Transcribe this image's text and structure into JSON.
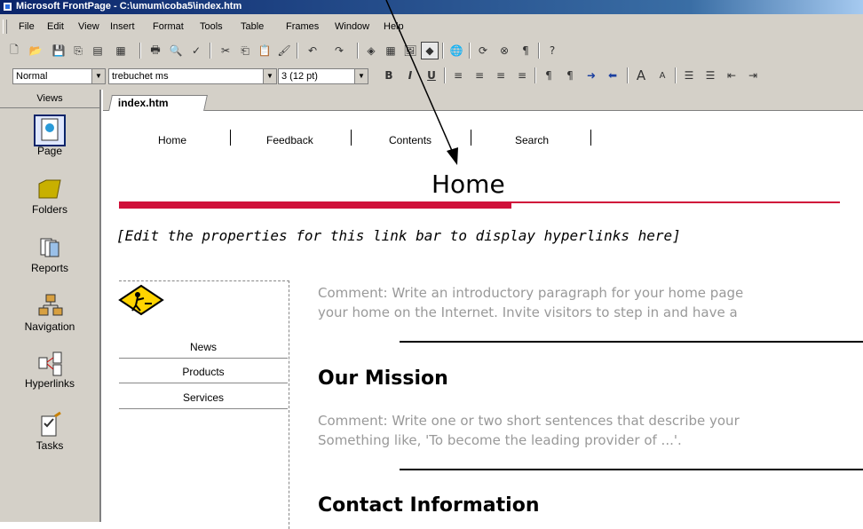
{
  "window": {
    "title": "Microsoft FrontPage - C:\\umum\\coba5\\index.htm"
  },
  "menu": [
    "File",
    "Edit",
    "View",
    "Insert",
    "Format",
    "Tools",
    "Table",
    "Frames",
    "Window",
    "Help"
  ],
  "formatting": {
    "style": "Normal",
    "font": "trebuchet ms",
    "size": "3  (12 pt)",
    "bold": "B",
    "italic": "I",
    "underline": "U"
  },
  "views": {
    "header": "Views",
    "items": [
      {
        "label": "Page",
        "icon": "page-icon"
      },
      {
        "label": "Folders",
        "icon": "folder-icon"
      },
      {
        "label": "Reports",
        "icon": "reports-icon"
      },
      {
        "label": "Navigation",
        "icon": "navigation-icon"
      },
      {
        "label": "Hyperlinks",
        "icon": "hyperlinks-icon"
      },
      {
        "label": "Tasks",
        "icon": "tasks-icon"
      }
    ]
  },
  "editor": {
    "tab": "index.htm",
    "nav_links": [
      "Home",
      "Feedback",
      "Contents",
      "Search"
    ],
    "heading": "Home",
    "linkbar_note": "[Edit the properties for this link bar to display hyperlinks here]",
    "side_links": [
      "News",
      "Products",
      "Services"
    ],
    "comment1_line1": "Comment: Write an introductory paragraph for your home page",
    "comment1_line2": "your home on the Internet. Invite visitors to step in and have a",
    "mission_title": "Our Mission",
    "comment2_line1": "Comment: Write one or two short sentences that describe your",
    "comment2_line2": "Something like, 'To become the leading provider of ...'.",
    "contact_title": "Contact Information"
  },
  "colors": {
    "titlebar": "#0a246a",
    "accent_red": "#d0103a",
    "chrome": "#d4d0c8"
  }
}
